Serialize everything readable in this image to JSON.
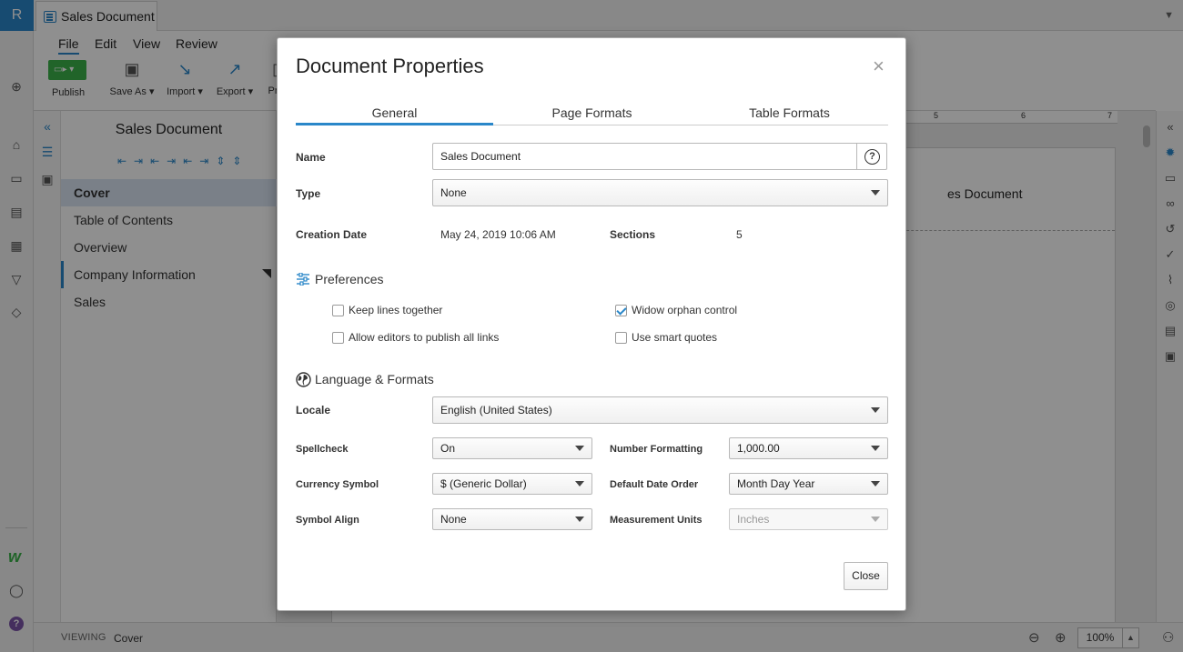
{
  "app": {
    "logo_letter": "R",
    "doc_tab": "Sales Document",
    "menu": [
      "File",
      "Edit",
      "View",
      "Review"
    ],
    "toolbar": {
      "publish": "Publish",
      "save_as": "Save As",
      "import": "Import",
      "export": "Export",
      "more": "Pr"
    },
    "outline": {
      "title": "Sales Document",
      "items": [
        "Cover",
        "Table of Contents",
        "Overview",
        "Company Information",
        "Sales"
      ]
    },
    "canvas": {
      "ruler_marks": [
        "5",
        "6",
        "7"
      ],
      "page_text": "es Document"
    },
    "status": {
      "viewing_label": "VIEWING",
      "page": "Cover",
      "zoom": "100%"
    }
  },
  "dialog": {
    "title": "Document Properties",
    "close_symbol": "×",
    "tabs": [
      "General",
      "Page Formats",
      "Table Formats"
    ],
    "active_tab": "General",
    "name_label": "Name",
    "name_value": "Sales Document",
    "help_symbol": "?",
    "type_label": "Type",
    "type_value": "None",
    "creation_label": "Creation Date",
    "creation_value": "May 24, 2019 10:06 AM",
    "sections_label": "Sections",
    "sections_value": "5",
    "preferences": {
      "heading": "Preferences",
      "keep_lines": {
        "label": "Keep lines together",
        "checked": false
      },
      "widow_orphan": {
        "label": "Widow orphan control",
        "checked": true
      },
      "allow_publish": {
        "label": "Allow editors to publish all links",
        "checked": false
      },
      "smart_quotes": {
        "label": "Use smart quotes",
        "checked": false
      }
    },
    "language": {
      "heading": "Language & Formats",
      "locale_label": "Locale",
      "locale_value": "English (United States)",
      "spellcheck_label": "Spellcheck",
      "spellcheck_value": "On",
      "number_label": "Number Formatting",
      "number_value": "1,000.00",
      "currency_label": "Currency Symbol",
      "currency_value": "$ (Generic Dollar)",
      "date_order_label": "Default Date Order",
      "date_order_value": "Month Day Year",
      "symbol_align_label": "Symbol Align",
      "symbol_align_value": "None",
      "units_label": "Measurement Units",
      "units_value": "Inches"
    },
    "close_button": "Close"
  },
  "colors": {
    "accent": "#2a87c9",
    "publish": "#3bb34a",
    "selected_row": "#d9e5f2"
  }
}
